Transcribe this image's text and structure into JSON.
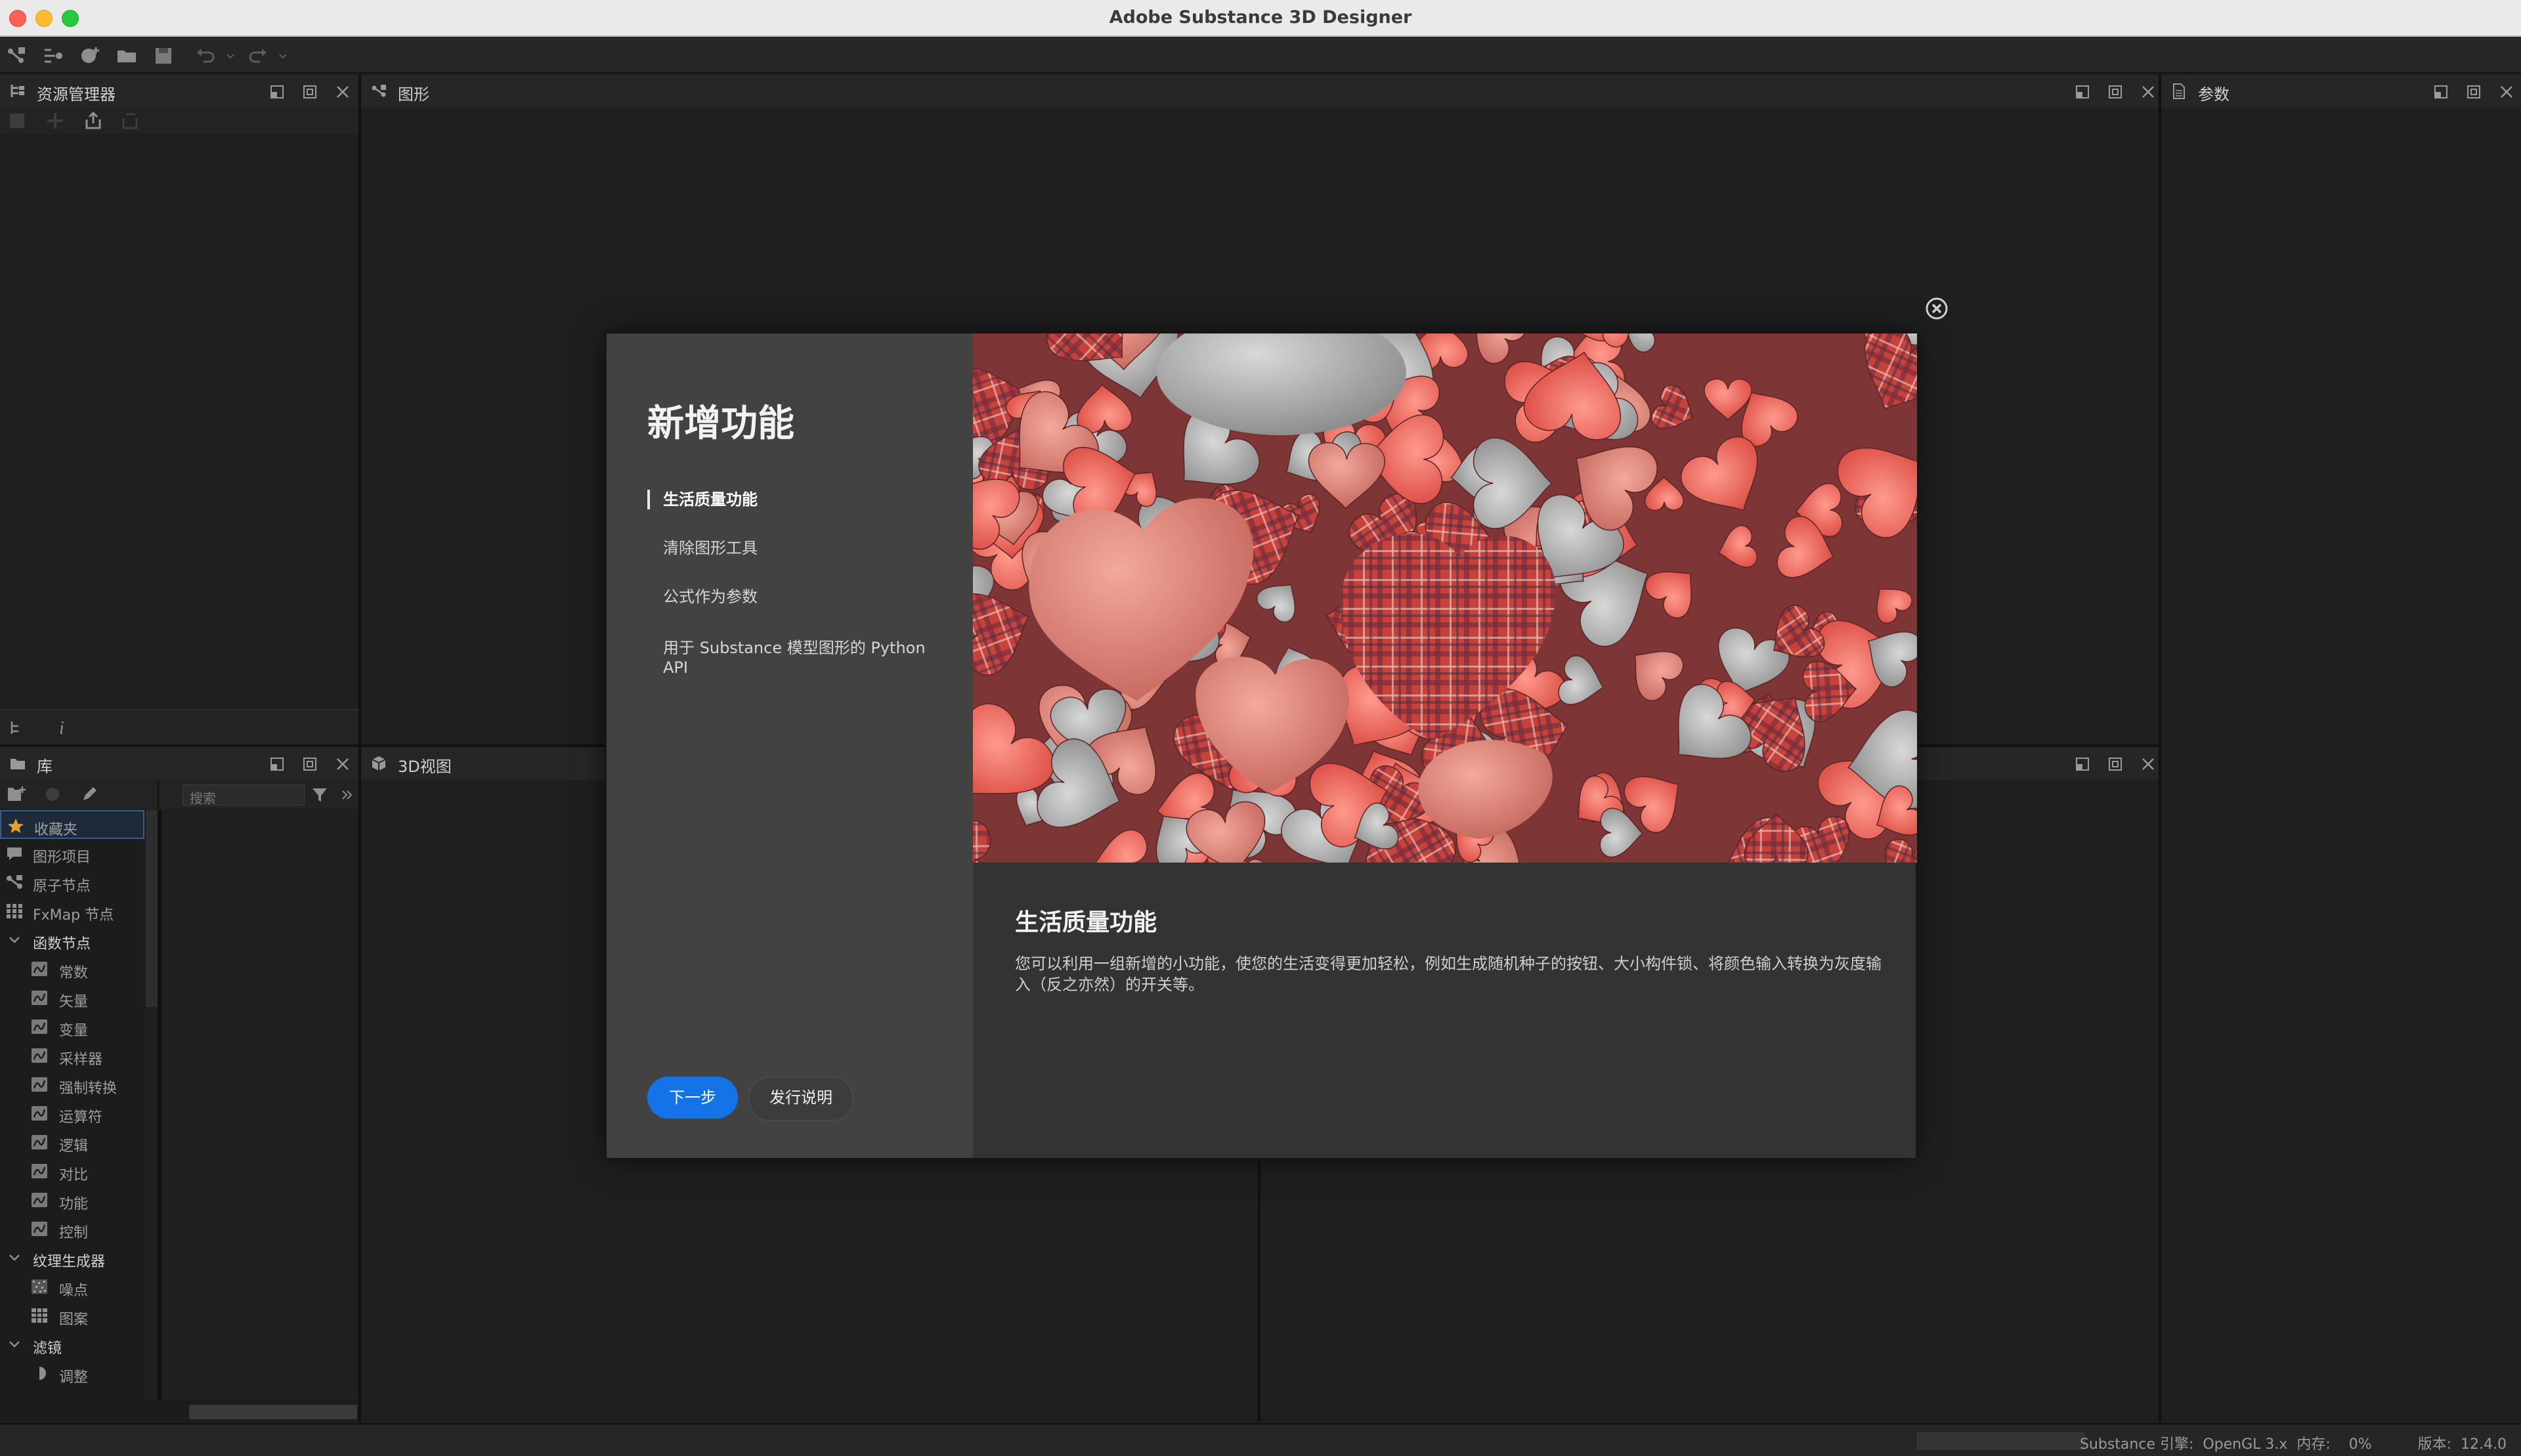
{
  "window": {
    "title": "Adobe Substance 3D Designer"
  },
  "panels": {
    "explorer": {
      "title": "资源管理器"
    },
    "graph": {
      "title": "图形"
    },
    "params": {
      "title": "参数"
    },
    "library": {
      "title": "库",
      "search_placeholder": "搜索"
    },
    "view3d": {
      "title": "3D视图"
    }
  },
  "library": {
    "items": [
      {
        "label": "收藏夹",
        "icon": "star-icon",
        "indent": false,
        "section": false,
        "selected": true
      },
      {
        "label": "图形项目",
        "icon": "comment-icon",
        "indent": false,
        "section": false
      },
      {
        "label": "原子节点",
        "icon": "node-icon",
        "indent": false,
        "section": false
      },
      {
        "label": "FxMap 节点",
        "icon": "grid-icon",
        "indent": false,
        "section": false
      },
      {
        "label": "函数节点",
        "icon": "chevron-down-icon",
        "indent": false,
        "section": true
      },
      {
        "label": "常数",
        "icon": "function-icon",
        "indent": true,
        "section": false
      },
      {
        "label": "矢量",
        "icon": "function-icon",
        "indent": true,
        "section": false
      },
      {
        "label": "变量",
        "icon": "function-icon",
        "indent": true,
        "section": false
      },
      {
        "label": "采样器",
        "icon": "function-icon",
        "indent": true,
        "section": false
      },
      {
        "label": "强制转换",
        "icon": "function-icon",
        "indent": true,
        "section": false
      },
      {
        "label": "运算符",
        "icon": "function-icon",
        "indent": true,
        "section": false
      },
      {
        "label": "逻辑",
        "icon": "function-icon",
        "indent": true,
        "section": false
      },
      {
        "label": "对比",
        "icon": "function-icon",
        "indent": true,
        "section": false
      },
      {
        "label": "功能",
        "icon": "function-icon",
        "indent": true,
        "section": false
      },
      {
        "label": "控制",
        "icon": "function-icon",
        "indent": true,
        "section": false
      },
      {
        "label": "纹理生成器",
        "icon": "chevron-down-icon",
        "indent": false,
        "section": true
      },
      {
        "label": "噪点",
        "icon": "noise-icon",
        "indent": true,
        "section": false
      },
      {
        "label": "图案",
        "icon": "pattern-icon",
        "indent": true,
        "section": false
      },
      {
        "label": "滤镜",
        "icon": "chevron-down-icon",
        "indent": false,
        "section": true
      },
      {
        "label": "调整",
        "icon": "adjust-icon",
        "indent": true,
        "section": false
      }
    ]
  },
  "dialog": {
    "heading": "新增功能",
    "nav": [
      {
        "label": "生活质量功能",
        "active": true
      },
      {
        "label": "清除图形工具",
        "active": false
      },
      {
        "label": "公式作为参数",
        "active": false
      },
      {
        "label": "用于 Substance 模型图形的 Python API",
        "active": false
      }
    ],
    "feature_title": "生活质量功能",
    "feature_desc": "您可以利用一组新增的小功能，使您的生活变得更加轻松，例如生成随机种子的按钮、大小构件锁、将颜色输入转换为灰度输入（反之亦然）的开关等。",
    "next_label": "下一步",
    "release_notes_label": "发行说明",
    "hero_image": "plaid-and-felt-hearts-pile"
  },
  "status": {
    "text": "Substance 引擎:  OpenGL 3.x  内存:    0%          版本:  12.4.0"
  },
  "colors": {
    "accent": "#1473e6",
    "panel_bg": "#1f1f1f",
    "header_bg": "#262626",
    "dialog_left": "#424242"
  }
}
